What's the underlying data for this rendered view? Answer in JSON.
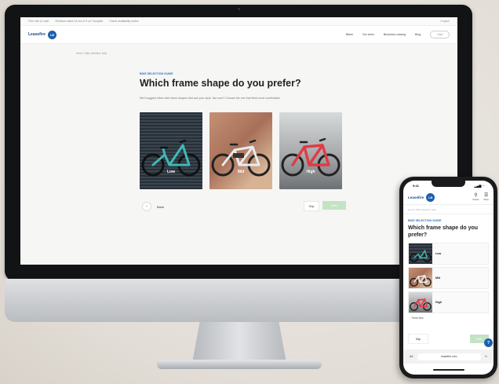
{
  "desktop": {
    "topbar": {
      "left_notes": [
        "Free ride & Cash",
        "Reviews rated 4.8 out of 5 on Trustpilot",
        "Check availability online"
      ],
      "right_note": "English"
    },
    "logo": {
      "text": "Leasefire",
      "badge": "LB"
    },
    "nav": {
      "links": [
        "Bikes",
        "Our store",
        "Business Leasing",
        "Blog"
      ],
      "cart_label": "Cart"
    },
    "breadcrumb": "Home / Bike selection help",
    "kicker": "BIKE SELECTION GUIDE",
    "title": "Which frame shape do you prefer?",
    "subtitle": "We'll suggest bikes with frame shapes that suit your style. Not sure? Choose the one that feels most comfortable.",
    "options": [
      {
        "label": "Low",
        "bike_color": "#3fb9b5"
      },
      {
        "label": "Mid",
        "bike_color": "#e9ebec"
      },
      {
        "label": "High",
        "bike_color": "#e23a44"
      }
    ],
    "back_label": "Back",
    "skip_label": "Skip",
    "next_label": "Next"
  },
  "phone": {
    "status": {
      "time": "9:41",
      "signal": "▂▄▆ ◔"
    },
    "logo": {
      "text": "Leasefire",
      "badge": "LB"
    },
    "nav_icons": [
      {
        "glyph": "⚲",
        "label": "Search"
      },
      {
        "glyph": "☰",
        "label": "Menu"
      }
    ],
    "breadcrumb": "Home / Bike selection help",
    "kicker": "BIKE SELECTION GUIDE",
    "title": "Which frame shape do you prefer?",
    "options": [
      {
        "label": "Low",
        "bike_color": "#3fb9b5"
      },
      {
        "label": "Mid",
        "bike_color": "#f1f1f1"
      },
      {
        "label": "High",
        "bike_color": "#e23a44"
      }
    ],
    "more_label": "↑ Show less",
    "skip_label": "Skip",
    "next_label": "Next",
    "chat_badge": "?",
    "url_aa": "AA",
    "url": "leasefire.com",
    "url_reload": "↻"
  },
  "colors": {
    "brand_blue": "#1d5fae",
    "kicker_blue": "#2b72b9",
    "next_green": "#c3e3c5"
  }
}
